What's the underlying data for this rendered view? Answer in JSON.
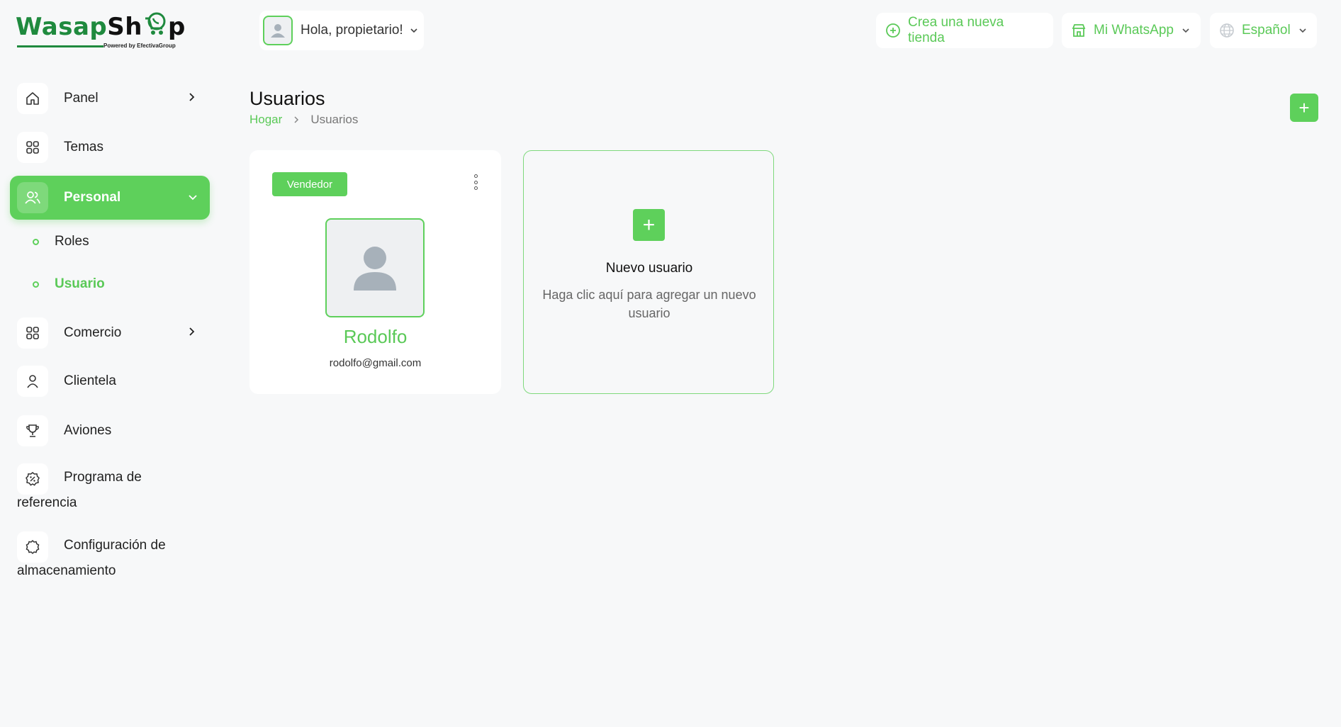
{
  "brand": {
    "name_part1": "Wasap",
    "name_part2": "Sh",
    "name_part3": "p",
    "tagline": "Powered by EfectivaGroup",
    "color": "#1f8a3e"
  },
  "header": {
    "greeting": "Hola, propietario!",
    "create_store": "Crea una nueva tienda",
    "whatsapp": "Mi WhatsApp",
    "language": "Español"
  },
  "sidebar": {
    "items": [
      {
        "label": "Panel",
        "icon": "home-icon"
      },
      {
        "label": "Temas",
        "icon": "grid-icon"
      },
      {
        "label": "Personal",
        "icon": "users-icon"
      },
      {
        "label": "Comercio",
        "icon": "grid-icon"
      },
      {
        "label": "Clientela",
        "icon": "user-icon"
      },
      {
        "label": "Aviones",
        "icon": "trophy-icon"
      },
      {
        "label_line1": "Programa de",
        "label_line2": "referencia",
        "icon": "badge-percent-icon"
      },
      {
        "label_line1": "Configuración de",
        "label_line2": "almacenamiento",
        "icon": "gear-icon"
      }
    ],
    "sub_items": [
      {
        "label": "Roles"
      },
      {
        "label": "Usuario"
      }
    ]
  },
  "main": {
    "title": "Usuarios",
    "breadcrumb": {
      "home": "Hogar",
      "current": "Usuarios"
    },
    "add_label": "+",
    "user_card": {
      "role": "Vendedor",
      "name": "Rodolfo",
      "email": "rodolfo@gmail.com"
    },
    "new_user_card": {
      "plus": "+",
      "title": "Nuevo usuario",
      "description": "Haga clic aquí para agregar un nuevo usuario"
    }
  },
  "colors": {
    "accent": "#5ed05b",
    "accent_text": "#5ac957",
    "background": "#f7f8f9"
  }
}
